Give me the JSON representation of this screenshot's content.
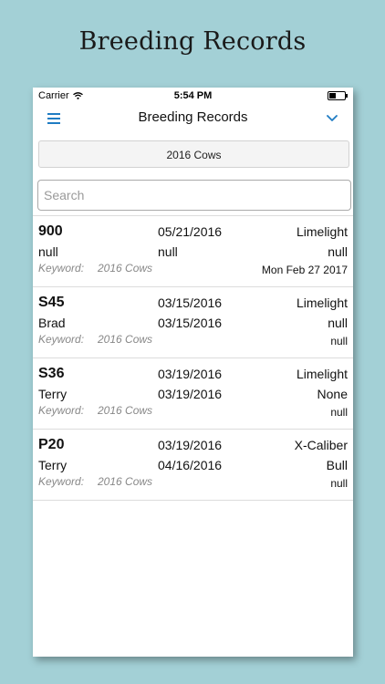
{
  "promo": {
    "title": "Breeding Records"
  },
  "status_bar": {
    "carrier": "Carrier",
    "time": "5:54 PM"
  },
  "nav": {
    "title": "Breeding Records"
  },
  "group_button": {
    "label": "2016 Cows"
  },
  "search": {
    "placeholder": "Search",
    "value": ""
  },
  "colors": {
    "accent": "#1f7cc3",
    "background": "#a3d0d6"
  },
  "icons": {
    "menu": "hamburger-menu-icon",
    "dropdown": "chevron-down-icon",
    "wifi": "wifi-icon",
    "battery": "battery-icon"
  },
  "records": [
    {
      "id": "900",
      "date1": "05/21/2016",
      "right1": "Limelight",
      "sub": "null",
      "date2": "null",
      "right2": "null",
      "keyword_label": "Keyword:",
      "keyword": "2016 Cows",
      "right3": "Mon Feb 27 2017"
    },
    {
      "id": "S45",
      "date1": "03/15/2016",
      "right1": "Limelight",
      "sub": "Brad",
      "date2": "03/15/2016",
      "right2": "null",
      "keyword_label": "Keyword:",
      "keyword": "2016 Cows",
      "right3": "null"
    },
    {
      "id": "S36",
      "date1": "03/19/2016",
      "right1": "Limelight",
      "sub": "Terry",
      "date2": "03/19/2016",
      "right2": "None",
      "keyword_label": "Keyword:",
      "keyword": "2016 Cows",
      "right3": "null"
    },
    {
      "id": "P20",
      "date1": "03/19/2016",
      "right1": "X-Caliber",
      "sub": "Terry",
      "date2": "04/16/2016",
      "right2": "Bull",
      "keyword_label": "Keyword:",
      "keyword": "2016 Cows",
      "right3": "null"
    }
  ]
}
